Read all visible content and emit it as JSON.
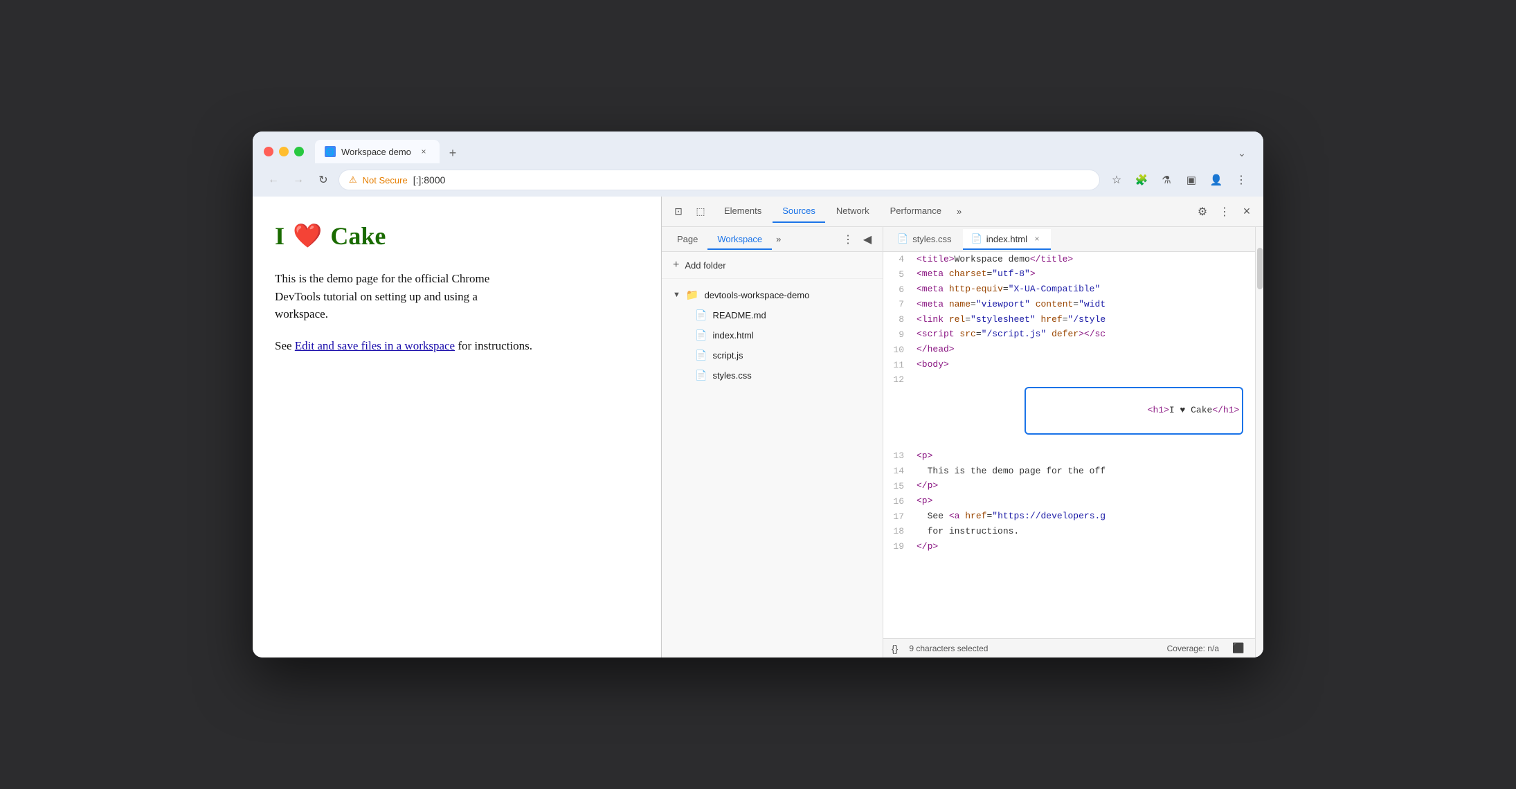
{
  "window": {
    "tab_title": "Workspace demo",
    "tab_favicon": "🌐",
    "tab_close": "×",
    "tab_new": "+",
    "tab_expand": "⌄"
  },
  "toolbar": {
    "back": "←",
    "forward": "→",
    "refresh": "↻",
    "not_secure_icon": "⚠",
    "not_secure_label": "Not Secure",
    "url": "[:]:8000",
    "bookmark": "☆",
    "extension": "🧩",
    "flask": "⚗",
    "sidebar": "▣",
    "avatar": "👤",
    "more": "⋮"
  },
  "page": {
    "heading": "I ❤ Cake",
    "paragraph1": "This is the demo page for the official Chrome\nDevTools tutorial on setting up and using a\nworkspace.",
    "paragraph2_before": "See ",
    "link_text": "Edit and save files in a workspace",
    "paragraph2_after": " for\ninstructions."
  },
  "devtools": {
    "panel_icon1": "⊡",
    "panel_icon2": "⬚",
    "tabs": [
      "Elements",
      "Sources",
      "Network",
      "Performance"
    ],
    "active_tab": "Sources",
    "more_tabs": "»",
    "settings_icon": "⚙",
    "kebab": "⋮",
    "close": "×",
    "sources": {
      "subtabs": [
        "Page",
        "Workspace"
      ],
      "active_subtab": "Workspace",
      "more": "»",
      "kebab": "⋮",
      "collapse": "◀",
      "add_folder_label": "Add folder",
      "folder_name": "devtools-workspace-demo",
      "files": [
        {
          "name": "README.md",
          "type": "md"
        },
        {
          "name": "index.html",
          "type": "html"
        },
        {
          "name": "script.js",
          "type": "js"
        },
        {
          "name": "styles.css",
          "type": "css"
        }
      ]
    },
    "editor": {
      "tabs": [
        {
          "name": "styles.css",
          "type": "css",
          "active": false
        },
        {
          "name": "index.html",
          "type": "html",
          "active": true
        }
      ],
      "lines": [
        {
          "num": 4,
          "code": "    <title>Workspace demo</title>",
          "type": "title_line"
        },
        {
          "num": 5,
          "code": "    <meta charset=\"utf-8\">",
          "type": "meta"
        },
        {
          "num": 6,
          "code": "    <meta http-equiv=\"X-UA-Compatible\"",
          "type": "meta2"
        },
        {
          "num": 7,
          "code": "    <meta name=\"viewport\" content=\"widt",
          "type": "meta3"
        },
        {
          "num": 8,
          "code": "    <link rel=\"stylesheet\" href=\"/style",
          "type": "link"
        },
        {
          "num": 9,
          "code": "    <script src=\"/script.js\" defer></sc",
          "type": "script_tag"
        },
        {
          "num": 10,
          "code": "  </head>",
          "type": "head_close"
        },
        {
          "num": 11,
          "code": "  <body>",
          "type": "body_open"
        },
        {
          "num": 12,
          "code": "    <h1>I ♥ Cake</h1>",
          "type": "h1_highlighted"
        },
        {
          "num": 13,
          "code": "    <p>",
          "type": "p_open"
        },
        {
          "num": 14,
          "code": "      This is the demo page for the off",
          "type": "text"
        },
        {
          "num": 15,
          "code": "    </p>",
          "type": "p_close"
        },
        {
          "num": 16,
          "code": "    <p>",
          "type": "p2_open"
        },
        {
          "num": 17,
          "code": "      See <a href=\"https://developers.g",
          "type": "a_tag"
        },
        {
          "num": 18,
          "code": "      for instructions.",
          "type": "instructions"
        },
        {
          "num": 19,
          "code": "    </p>",
          "type": "p2_close"
        }
      ]
    },
    "statusbar": {
      "braces": "{}",
      "selected": "9 characters selected",
      "coverage": "Coverage: n/a",
      "screenshot": "⬛"
    }
  }
}
